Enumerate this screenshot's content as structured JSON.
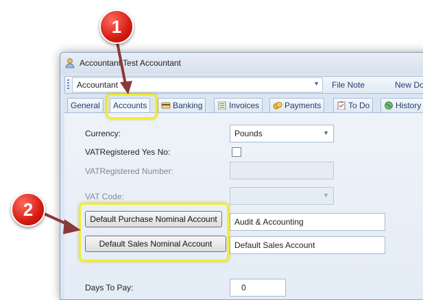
{
  "window": {
    "title": "Accountant Test Accountant"
  },
  "toolbar": {
    "combo_value": "Accountant",
    "file_note_label": "File Note",
    "new_doc_label": "New Do"
  },
  "tabs": [
    {
      "label": "General",
      "icon": "none"
    },
    {
      "label": "Accounts",
      "icon": "none",
      "active": true
    },
    {
      "label": "Banking",
      "icon": "card-icon"
    },
    {
      "label": "Invoices",
      "icon": "invoice-icon"
    },
    {
      "label": "Payments",
      "icon": "coins-icon"
    },
    {
      "label": "To Do",
      "icon": "todo-icon"
    },
    {
      "label": "History",
      "icon": "globe-icon"
    }
  ],
  "form": {
    "currency_label": "Currency:",
    "currency_value": "Pounds",
    "vat_registered_label": "VATRegistered Yes No:",
    "vat_registered_checked": false,
    "vat_number_label": "VATRegistered Number:",
    "vat_code_label": "VAT Code:",
    "purchase_button_label": "Default Purchase Nominal Account",
    "purchase_value": "Audit & Accounting",
    "sales_button_label": "Default Sales Nominal Account",
    "sales_value": "Default Sales Account",
    "days_label": "Days To Pay:",
    "days_value": "0"
  },
  "callouts": [
    "1",
    "2"
  ],
  "colors": {
    "highlight": "#f1ee2b",
    "callout": "#d61b12",
    "arrow": "#8a3a3a"
  }
}
